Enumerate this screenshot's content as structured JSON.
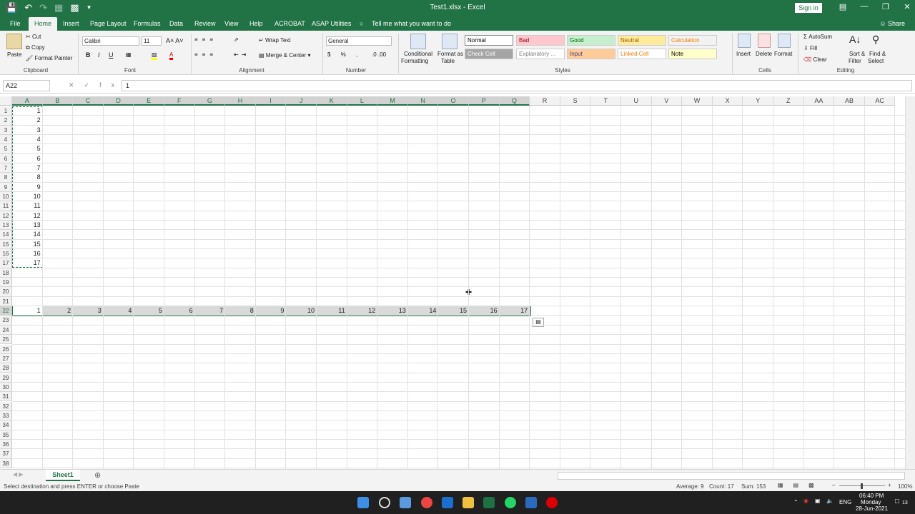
{
  "titlebar": {
    "title": "Test1.xlsx  -  Excel",
    "signin": "Sign in"
  },
  "tabs": [
    "File",
    "Home",
    "Insert",
    "Page Layout",
    "Formulas",
    "Data",
    "Review",
    "View",
    "Help",
    "ACROBAT",
    "ASAP Utilities"
  ],
  "tell_me": "Tell me what you want to do",
  "share": "Share",
  "clipboard": {
    "paste": "Paste",
    "cut": "Cut",
    "copy": "Copy",
    "format_painter": "Format Painter",
    "label": "Clipboard"
  },
  "font": {
    "name": "Calibri",
    "size": "11",
    "label": "Font"
  },
  "alignment": {
    "wrap": "Wrap Text",
    "merge": "Merge & Center",
    "label": "Alignment"
  },
  "number": {
    "format": "General",
    "label": "Number"
  },
  "styles": {
    "cond1": "Conditional",
    "cond2": "Formatting",
    "fmt1": "Format as",
    "fmt2": "Table",
    "label": "Styles",
    "cells": [
      {
        "name": "Normal",
        "bg": "#ffffff",
        "fg": "#000000"
      },
      {
        "name": "Bad",
        "bg": "#ffc7ce",
        "fg": "#9c0006"
      },
      {
        "name": "Good",
        "bg": "#c6efce",
        "fg": "#006100"
      },
      {
        "name": "Neutral",
        "bg": "#ffeb9c",
        "fg": "#9c5700"
      },
      {
        "name": "Calculation",
        "bg": "#f2f2f2",
        "fg": "#fa7d00"
      },
      {
        "name": "Check Cell",
        "bg": "#a5a5a5",
        "fg": "#ffffff"
      },
      {
        "name": "Explanatory ...",
        "bg": "#ffffff",
        "fg": "#7f7f7f"
      },
      {
        "name": "Input",
        "bg": "#ffcc99",
        "fg": "#3f3f76"
      },
      {
        "name": "Linked Cell",
        "bg": "#ffffff",
        "fg": "#fa7d00"
      },
      {
        "name": "Note",
        "bg": "#ffffcc",
        "fg": "#000000"
      }
    ]
  },
  "cells_group": {
    "insert": "Insert",
    "delete": "Delete",
    "format": "Format",
    "label": "Cells"
  },
  "editing": {
    "autosum": "AutoSum",
    "fill": "Fill",
    "clear": "Clear",
    "sort1": "Sort &",
    "sort2": "Filter",
    "find1": "Find &",
    "find2": "Select",
    "label": "Editing"
  },
  "formula": {
    "namebox": "A22",
    "fx": "fx",
    "value": "1"
  },
  "columns": [
    "A",
    "B",
    "C",
    "D",
    "E",
    "F",
    "G",
    "H",
    "I",
    "J",
    "K",
    "L",
    "M",
    "N",
    "O",
    "P",
    "Q",
    "R",
    "S",
    "T",
    "U",
    "V",
    "W",
    "X",
    "Y",
    "Z",
    "AA",
    "AB",
    "AC"
  ],
  "rows": [
    "1",
    "2",
    "3",
    "4",
    "5",
    "6",
    "7",
    "8",
    "9",
    "10",
    "11",
    "12",
    "13",
    "14",
    "15",
    "16",
    "17",
    "18",
    "19",
    "20",
    "21",
    "22",
    "23",
    "24",
    "25",
    "26",
    "27",
    "28",
    "29",
    "30",
    "31",
    "32",
    "33",
    "34",
    "35",
    "36",
    "37",
    "38"
  ],
  "col_a_values": [
    "1",
    "2",
    "3",
    "4",
    "5",
    "6",
    "7",
    "8",
    "9",
    "10",
    "11",
    "12",
    "13",
    "14",
    "15",
    "16",
    "17"
  ],
  "row22_values": [
    "1",
    "2",
    "3",
    "4",
    "5",
    "6",
    "7",
    "8",
    "9",
    "10",
    "11",
    "12",
    "13",
    "14",
    "15",
    "16",
    "17"
  ],
  "sheet": "Sheet1",
  "status": {
    "msg": "Select destination and press ENTER or choose Paste",
    "average": "Average: 9",
    "count": "Count: 17",
    "sum": "Sum: 153",
    "zoom": "100%"
  },
  "taskbar": {
    "lang": "ENG",
    "time": "06:40 PM",
    "day": "Monday",
    "date": "28-Jun-2021",
    "notif": "13"
  }
}
